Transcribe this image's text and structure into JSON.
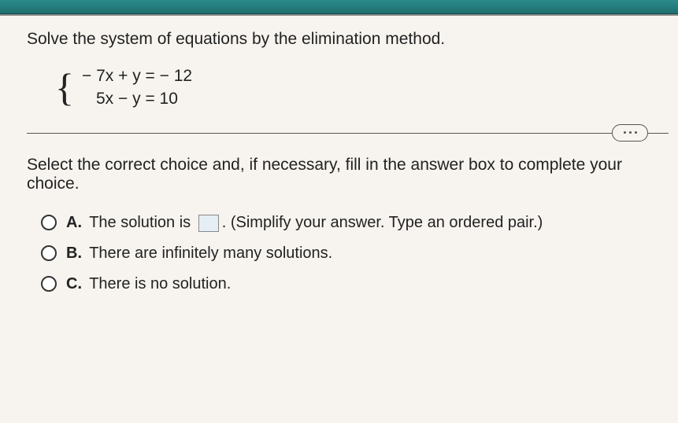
{
  "instruction": "Solve the system of equations by the elimination method.",
  "equations": {
    "eq1": "− 7x + y = − 12",
    "eq2": "5x − y = 10"
  },
  "prompt": "Select the correct choice and, if necessary, fill in the answer box to complete your choice.",
  "choices": {
    "a": {
      "letter": "A.",
      "pre": "The solution is",
      "post": ". (Simplify your answer. Type an ordered pair.)"
    },
    "b": {
      "letter": "B.",
      "text": "There are infinitely many solutions."
    },
    "c": {
      "letter": "C.",
      "text": "There is no solution."
    }
  }
}
